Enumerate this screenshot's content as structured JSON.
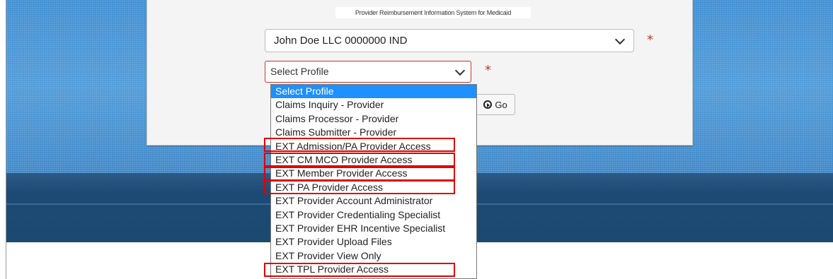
{
  "header": {
    "logo_text": "Provider Reimbursement Information System for Medicaid"
  },
  "form": {
    "provider_value": "John Doe LLC 0000000 IND",
    "profile_value": "Select Profile",
    "required_marker": "*",
    "go_label": "Go"
  },
  "dropdown": {
    "options": [
      "Select Profile",
      "Claims Inquiry - Provider",
      "Claims Processor - Provider",
      "Claims Submitter - Provider",
      "EXT Admission/PA Provider Access",
      "EXT CM MCO Provider Access",
      "EXT Member Provider Access",
      "EXT PA Provider Access",
      "EXT Provider Account Administrator",
      "EXT Provider Credentialing Specialist",
      "EXT Provider EHR Incentive Specialist",
      "EXT Provider Upload Files",
      "EXT Provider View Only",
      "EXT TPL Provider Access"
    ],
    "selected_index": 0,
    "highlighted_options": [
      "EXT Admission/PA Provider Access",
      "EXT CM MCO Provider Access",
      "EXT Member Provider Access",
      "EXT PA Provider Access",
      "EXT TPL Provider Access"
    ]
  },
  "colors": {
    "banner_blue": "#3d88c9",
    "dark_band": "#1d4a74",
    "selected_option": "#1e90ff",
    "required_red": "#c0392b",
    "highlight_box": "#e00000"
  }
}
